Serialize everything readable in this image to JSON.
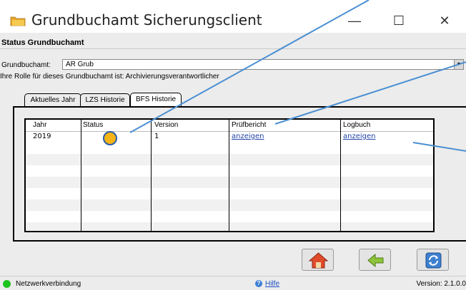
{
  "window": {
    "title": "Grundbuchamt Sicherungsclient",
    "minimize_symbol": "—",
    "maximize_symbol": "☐",
    "close_symbol": "✕"
  },
  "header": {
    "status_heading": "Status Grundbuchamt",
    "grundbuchamt_label": "Grundbuchamt:",
    "grundbuchamt_value": "AR Grub",
    "rolle_text": "Ihre Rolle für dieses Grundbuchamt ist: Archivierungsverantwortlicher"
  },
  "tabs": [
    {
      "label": "Aktuelles Jahr"
    },
    {
      "label": "LZS Historie"
    },
    {
      "label": "BFS Historie"
    }
  ],
  "table": {
    "columns": [
      "Jahr",
      "Status",
      "Version",
      "Prüfbericht",
      "Logbuch"
    ],
    "rows": [
      {
        "jahr": "2019",
        "status_color": "#f5b318",
        "version": "1",
        "pruefbericht": "anzeigen",
        "logbuch": "anzeigen"
      }
    ]
  },
  "nav_buttons": [
    {
      "icon": "home-icon"
    },
    {
      "icon": "back-arrow-icon"
    },
    {
      "icon": "refresh-icon"
    }
  ],
  "statusbar": {
    "network_label": "Netzwerkverbindung",
    "network_color": "#1ec41e",
    "help_label": "Hilfe",
    "version": "Version: 2.1.0.0"
  }
}
